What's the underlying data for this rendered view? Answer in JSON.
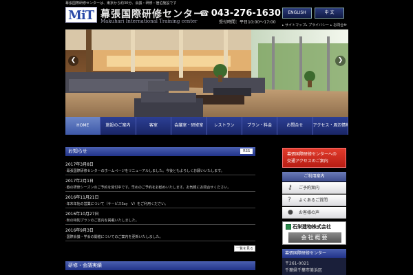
{
  "header": {
    "topline": "幕張国際研修センターは、東京から約30分、会議・研修・宿泊施設です",
    "logo_text": "MiT",
    "brand_jp": "幕張国際研修センター",
    "brand_en": "Makuhari International Training center",
    "phone": "043-276-1630",
    "hours": "受付時間：平日10:00～17:00",
    "lang_en": "ENGLISH",
    "lang_zh": "中 文",
    "links": [
      "▸ サイトマップ",
      "▸ プライバシー",
      "▸ お問合せ"
    ]
  },
  "hero": {
    "prev": "❮",
    "next": "❯"
  },
  "nav": {
    "items": [
      "HOME",
      "施設のご案内",
      "客室",
      "会議室・研修室",
      "レストラン",
      "プラン・料金",
      "お問合せ",
      "アクセス・周辺情報"
    ]
  },
  "news": {
    "heading": "お知らせ",
    "rss": "RSS",
    "items": [
      {
        "date": "2017年3月8日",
        "title": "幕張国際研修センターのホームページをリニューアルしました。今後ともよろしくお願いいたします。"
      },
      {
        "date": "2017年2月1日",
        "title": "春の研修シーズンのご予約を受付中です。早めのご予約をお勧めいたします。お気軽にお問合せください。"
      },
      {
        "date": "2016年11月21日",
        "title": "年末年始の営業について（サービスSay　V）をご利用ください。"
      },
      {
        "date": "2016年10月27日",
        "title": "秋の特別プランのご案内を掲載いたしました。"
      },
      {
        "date": "2016年9月3日",
        "title": "国際会議・学会の開催についてのご案内を更新いたしました。"
      }
    ],
    "list_button": "一覧を見る"
  },
  "second_panel": {
    "heading": "研修・会議実績"
  },
  "sidebar": {
    "access_line1": "幕張国際研修センターへの",
    "access_line2": "交通アクセスのご案内",
    "info_heading": "ご利用案内",
    "links": [
      {
        "icon": "key-icon",
        "glyph": "⚷",
        "label": "ご予約案内"
      },
      {
        "icon": "question-icon",
        "glyph": "?",
        "label": "よくあるご質問"
      },
      {
        "icon": "speech-bubble-icon",
        "glyph": "●",
        "label": "お客様の声"
      }
    ],
    "company_name": "石栄建物株式会社",
    "company_button": "会社概要",
    "address_heading": "幕張国際研修センター",
    "zip": "〒261-0021",
    "address": "千葉県千葉市美浜区"
  },
  "colors": {
    "nav_blue": "#2c3f95",
    "nav_active": "#6d87c8",
    "accent_red": "#e13b2b",
    "background": "#000000"
  }
}
